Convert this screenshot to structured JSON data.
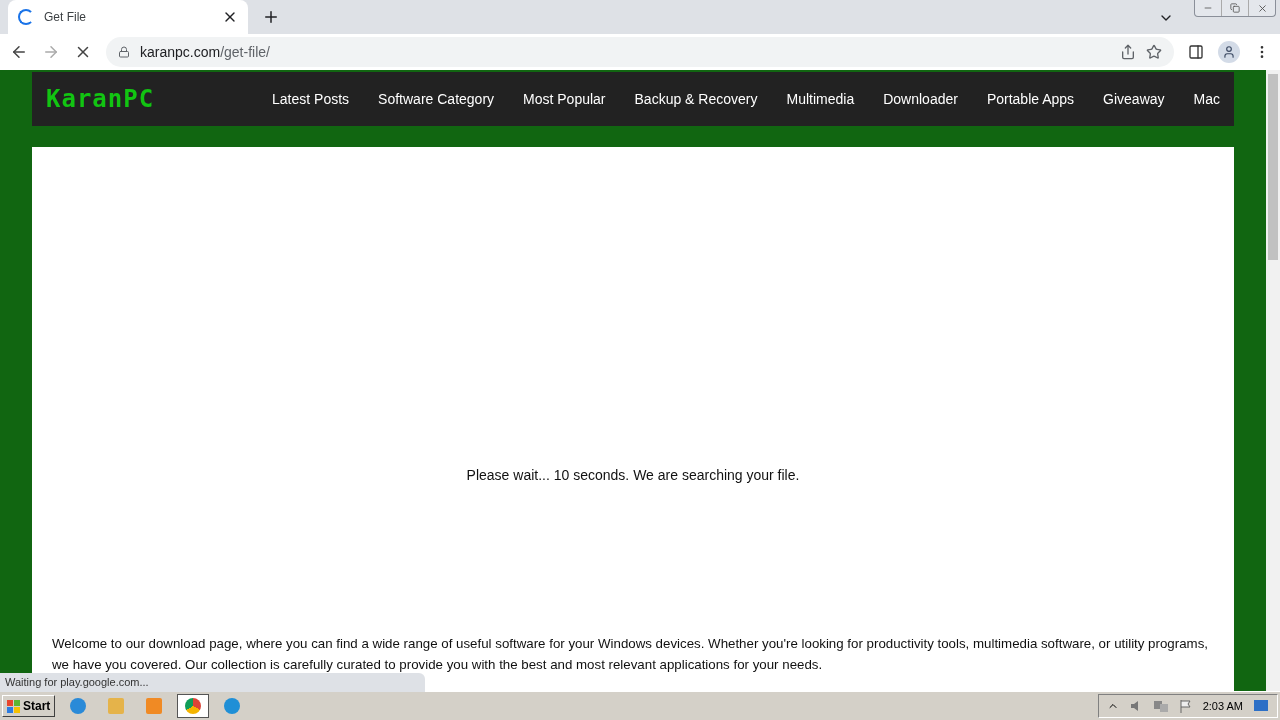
{
  "browser": {
    "tab": {
      "title": "Get File",
      "loading": true
    },
    "address": {
      "host": "karanpc.com",
      "path": "/get-file/"
    }
  },
  "site": {
    "logo": "KaranPC",
    "nav": [
      "Latest Posts",
      "Software Category",
      "Most Popular",
      "Backup & Recovery",
      "Multimedia",
      "Downloader",
      "Portable Apps",
      "Giveaway",
      "Mac"
    ],
    "wait_message": "Please wait... 10 seconds. We are searching your file.",
    "intro": "Welcome to our download page, where you can find a wide range of useful software for your Windows devices. Whether you're looking for productivity tools, multimedia software, or utility programs, we have you covered. Our collection is carefully curated to provide you with the best and most relevant applications for your needs."
  },
  "status_bar": "Waiting for play.google.com...",
  "taskbar": {
    "start": "Start",
    "clock": "2:03 AM"
  }
}
